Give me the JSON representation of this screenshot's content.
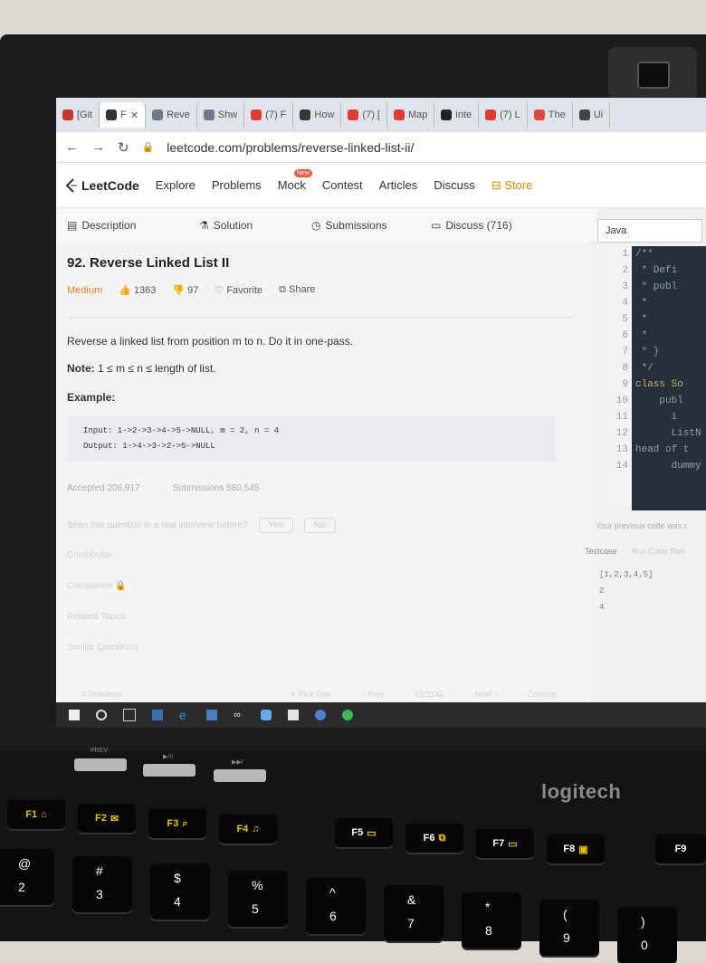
{
  "browser": {
    "tabs": [
      {
        "label": "[Git",
        "color": "#c5362c"
      },
      {
        "label": "F",
        "color": "#333333",
        "active": true
      },
      {
        "label": "Reve",
        "color": "#6b7b8a"
      },
      {
        "label": "Shw",
        "color": "#6b7b8a"
      },
      {
        "label": "(7) F",
        "color": "#e53935"
      },
      {
        "label": "How",
        "color": "#2f3b2f"
      },
      {
        "label": "(7) [",
        "color": "#e53935"
      },
      {
        "label": "Map",
        "color": "#e53935"
      },
      {
        "label": "inte",
        "color": "#222222"
      },
      {
        "label": "(7) L",
        "color": "#e53935"
      },
      {
        "label": "The",
        "color": "#d94a3c"
      },
      {
        "label": "Ui",
        "color": "#444444"
      }
    ],
    "url": "leetcode.com/problems/reverse-linked-list-ii/"
  },
  "nav": {
    "logo": "LeetCode",
    "links": [
      "Explore",
      "Problems",
      "Mock",
      "Contest",
      "Articles",
      "Discuss"
    ],
    "new_badge": "New",
    "store": "Store"
  },
  "subtabs": {
    "description": "Description",
    "solution": "Solution",
    "submissions": "Submissions",
    "discuss": "Discuss (716)"
  },
  "problem": {
    "title": "92. Reverse Linked List II",
    "difficulty": "Medium",
    "likes": "1363",
    "dislikes": "97",
    "favorite": "Favorite",
    "share": "Share",
    "statement": "Reverse a linked list from position m to n. Do it in one-pass.",
    "note_label": "Note:",
    "note": "1 ≤ m ≤ n ≤ length of list.",
    "example_label": "Example:",
    "input_line": "Input: 1->2->3->4->5->NULL, m = 2, n = 4",
    "output_line": "Output: 1->4->3->2->5->NULL",
    "accepted": "Accepted  206,917",
    "submissions": "Submissions  580,545",
    "seen_question": "Seen this question in a real interview before?",
    "yes": "Yes",
    "no": "No",
    "contributor": "Contributor",
    "companies": "Companies",
    "related_topics": "Related Topics",
    "similar_questions": "Similar Questions"
  },
  "footer": {
    "problems": "≡ Problems",
    "pick_one": "✕ Pick One",
    "prev": "‹ Prev",
    "page": "92/1142",
    "next": "Next ›"
  },
  "editor": {
    "language": "Java",
    "line_numbers": [
      "1",
      "2",
      "3",
      "4",
      "5",
      "6",
      "7",
      "8",
      "9",
      "10",
      "11",
      "12",
      "13",
      "14"
    ],
    "code_lines": [
      "/**",
      " * Defi",
      " * publ",
      " *",
      " *",
      " *",
      " * }",
      " */",
      "class So",
      "    publ",
      "      i",
      "      ListN",
      "head of t",
      "      dummy"
    ],
    "previous_code": "Your previous code was r",
    "testcase_tab": "Testcase",
    "run_code": "Run Code Res",
    "testcase_values": [
      "[1,2,3,4,5]",
      "2",
      "4"
    ],
    "console": "Console"
  },
  "keyboard": {
    "brand": "logitech",
    "media": [
      "PREV",
      "▶/II",
      "▶▶I"
    ],
    "fkeys": [
      "F1",
      "F2",
      "F3",
      "F4",
      "F5",
      "F6",
      "F7",
      "F8",
      "F9"
    ],
    "numkeys": [
      {
        "top": "@",
        "bottom": "2"
      },
      {
        "top": "#",
        "bottom": "3"
      },
      {
        "top": "$",
        "bottom": "4"
      },
      {
        "top": "%",
        "bottom": "5"
      },
      {
        "top": "^",
        "bottom": "6"
      },
      {
        "top": "&",
        "bottom": "7"
      },
      {
        "top": "*",
        "bottom": "8"
      },
      {
        "top": "(",
        "bottom": "9"
      },
      {
        "top": ")",
        "bottom": "0"
      }
    ]
  }
}
